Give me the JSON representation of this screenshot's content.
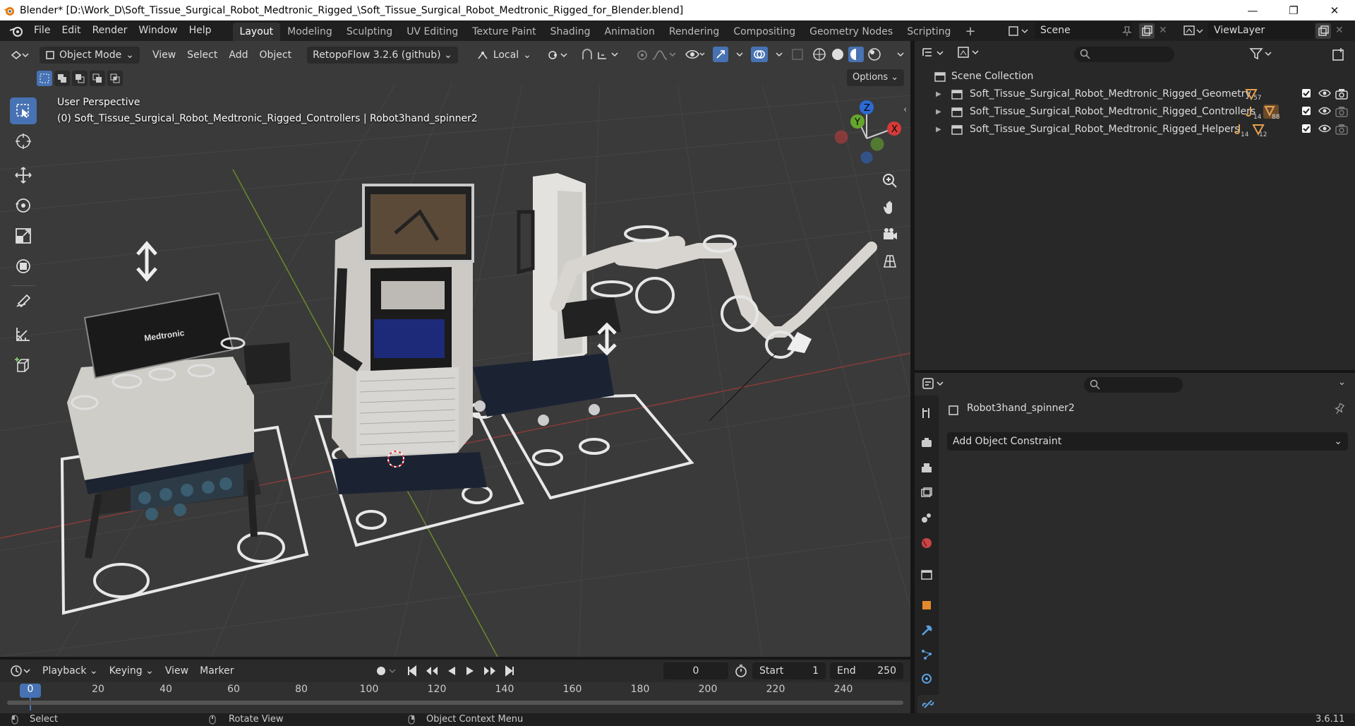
{
  "window": {
    "title": "Blender* [D:\\Work_D\\Soft_Tissue_Surgical_Robot_Medtronic_Rigged_\\Soft_Tissue_Surgical_Robot_Medtronic_Rigged_for_Blender.blend]",
    "minimize": "—",
    "maximize": "❐",
    "close": "✕"
  },
  "menu": [
    "File",
    "Edit",
    "Render",
    "Window",
    "Help"
  ],
  "workspaces": [
    "Layout",
    "Modeling",
    "Sculpting",
    "UV Editing",
    "Texture Paint",
    "Shading",
    "Animation",
    "Rendering",
    "Compositing",
    "Geometry Nodes",
    "Scripting"
  ],
  "active_workspace": "Layout",
  "add_workspace": "+",
  "scene": "Scene",
  "view_layer": "ViewLayer",
  "viewport": {
    "mode": "Object Mode",
    "menus": [
      "View",
      "Select",
      "Add",
      "Object"
    ],
    "addon": "RetopoFlow 3.2.6 (github)",
    "orientation": "Local",
    "options": "Options",
    "perspective": "User Perspective",
    "active_info": "(0) Soft_Tissue_Surgical_Robot_Medtronic_Rigged_Controllers | Robot3hand_spinner2",
    "gizmo": {
      "x": "X",
      "y": "Y",
      "z": "Z"
    },
    "brand": "Medtronic"
  },
  "outliner": {
    "root": "Scene Collection",
    "rows": [
      {
        "name": "Soft_Tissue_Surgical_Robot_Medtronic_Rigged_Geometry",
        "badge1": "57",
        "badge2": ""
      },
      {
        "name": "Soft_Tissue_Surgical_Robot_Medtronic_Rigged_Controllers",
        "badge1": "14",
        "badge2": "88"
      },
      {
        "name": "Soft_Tissue_Surgical_Robot_Medtronic_Rigged_Helpers",
        "badge1": "14",
        "badge2": "12"
      }
    ]
  },
  "properties": {
    "object_name": "Robot3hand_spinner2",
    "add_constraint": "Add Object Constraint"
  },
  "timeline": {
    "menus": [
      "Playback",
      "Keying",
      "View",
      "Marker"
    ],
    "current_frame": "0",
    "start_label": "Start",
    "start": "1",
    "end_label": "End",
    "end": "250",
    "ticks": [
      "0",
      "20",
      "40",
      "60",
      "80",
      "100",
      "120",
      "140",
      "160",
      "180",
      "200",
      "220",
      "240"
    ]
  },
  "statusbar": {
    "select": "Select",
    "rotate": "Rotate View",
    "context": "Object Context Menu",
    "version": "3.6.11"
  }
}
